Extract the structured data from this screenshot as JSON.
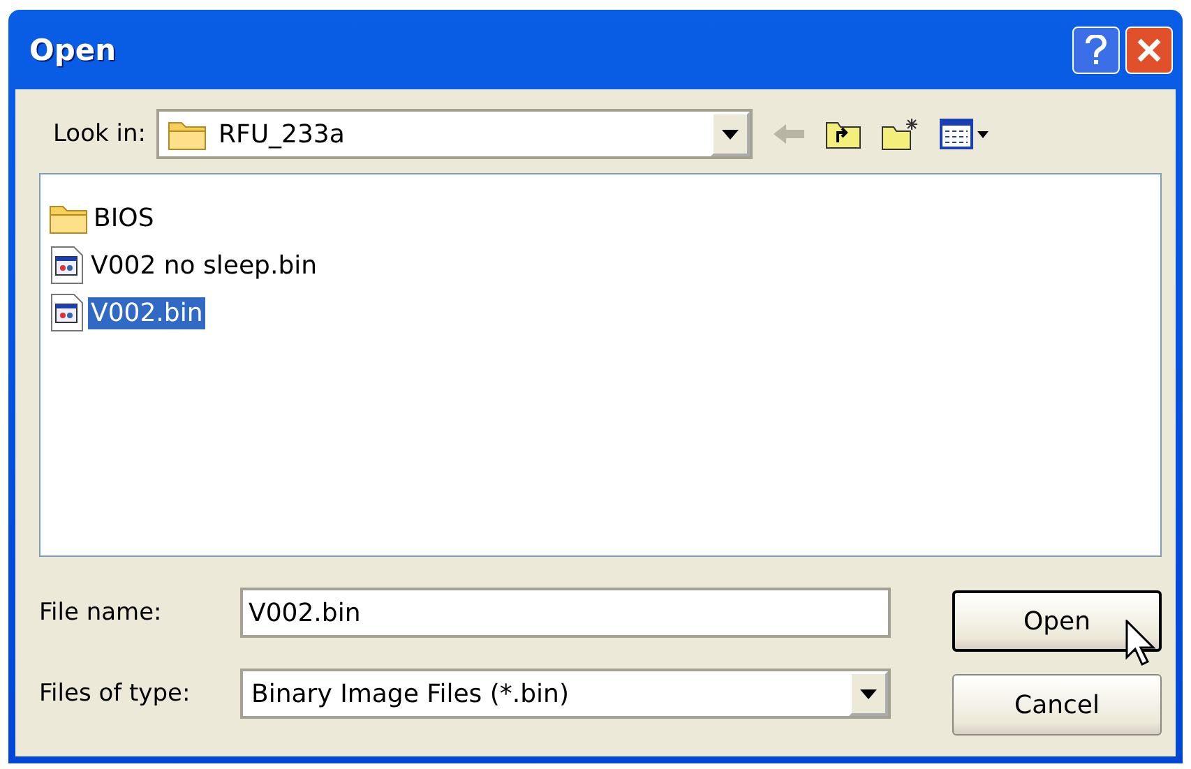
{
  "window": {
    "title": "Open"
  },
  "look_in": {
    "label": "Look in:",
    "value": "RFU_233a"
  },
  "files": [
    {
      "kind": "folder",
      "name": "BIOS",
      "selected": false
    },
    {
      "kind": "file",
      "name": "V002 no sleep.bin",
      "selected": false
    },
    {
      "kind": "file",
      "name": "V002.bin",
      "selected": true
    }
  ],
  "file_name": {
    "label": "File name:",
    "value": "V002.bin"
  },
  "file_type": {
    "label": "Files of type:",
    "value": "Binary Image Files (*.bin)"
  },
  "buttons": [
    {
      "label": "Open",
      "default": true
    },
    {
      "label": "Cancel",
      "default": false
    }
  ]
}
